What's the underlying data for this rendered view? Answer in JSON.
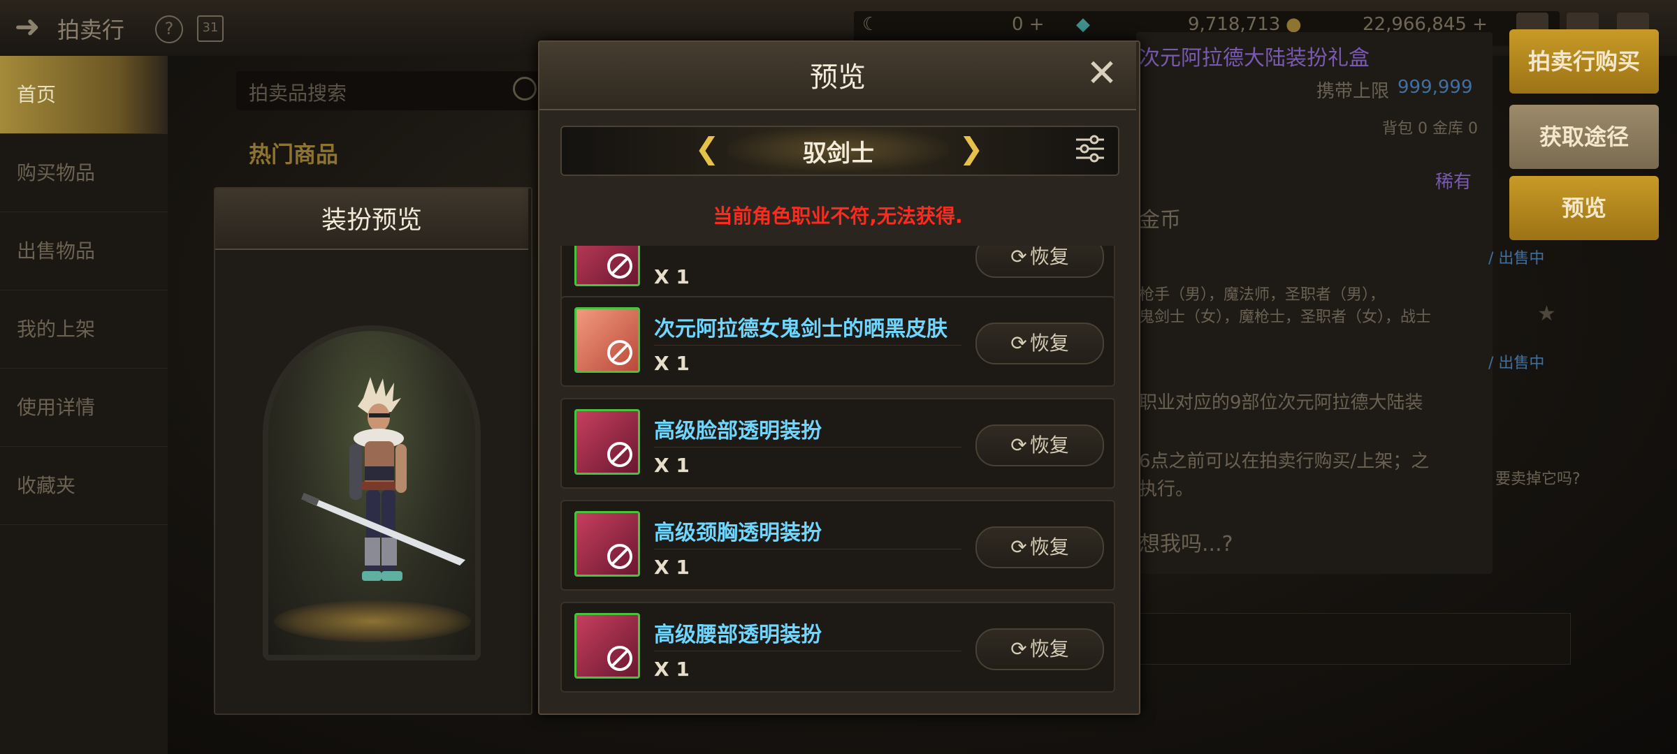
{
  "topbar": {
    "title": "拍卖行",
    "currency": [
      {
        "icon": "moon-coin-icon",
        "value": "0 +"
      },
      {
        "icon": "crystal-icon",
        "value": "9,718,713 +"
      },
      {
        "icon": "gold-coin-icon",
        "value": "22,966,845 +"
      }
    ]
  },
  "sidebar": {
    "items": [
      {
        "label": "首页",
        "active": true
      },
      {
        "label": "购买物品"
      },
      {
        "label": "出售物品"
      },
      {
        "label": "我的上架"
      },
      {
        "label": "使用详情"
      },
      {
        "label": "收藏夹"
      }
    ]
  },
  "search": {
    "placeholder": "拍卖品搜索"
  },
  "hot": {
    "title": "热门商品"
  },
  "right_buttons": {
    "buy": "拍卖行购买",
    "source": "获取途径",
    "preview": "预览"
  },
  "detail_bg": {
    "title": "次元阿拉德大陆装扮礼盒",
    "limit_label": "携带上限",
    "limit_value": "999,999",
    "bag": "背包 0 金库 0",
    "rarity": "稀有",
    "coin": "金币",
    "link1": "/ 出售中",
    "link2": "/ 出售中",
    "desc1": "枪手（男），魔法师，圣职者（男），",
    "desc2": "鬼剑士（女），魔枪士，圣职者（女），战士",
    "desc3": "职业对应的9部位次元阿拉德大陆装",
    "desc4": "6点之前可以在拍卖行购买/上架；之",
    "desc5": "执行。",
    "desc6": "想我吗...?",
    "side_q": "要卖掉它吗?"
  },
  "outfit_panel": {
    "title": "装扮预览"
  },
  "dialog": {
    "title": "预览",
    "class_name": "驭剑士",
    "warning": "当前角色职业不符,无法获得.",
    "items": [
      {
        "name": "",
        "qty": "X 1",
        "button": "恢复",
        "icon": "partial-outfit-icon"
      },
      {
        "name": "次元阿拉德女鬼剑士的晒黑皮肤",
        "qty": "X 1",
        "button": "恢复",
        "icon": "tan-skin-icon"
      },
      {
        "name": "高级脸部透明装扮",
        "qty": "X 1",
        "button": "恢复",
        "icon": "face-outfit-icon"
      },
      {
        "name": "高级颈胸透明装扮",
        "qty": "X 1",
        "button": "恢复",
        "icon": "neck-chest-outfit-icon"
      },
      {
        "name": "高级腰部透明装扮",
        "qty": "X 1",
        "button": "恢复",
        "icon": "waist-outfit-icon"
      }
    ]
  }
}
